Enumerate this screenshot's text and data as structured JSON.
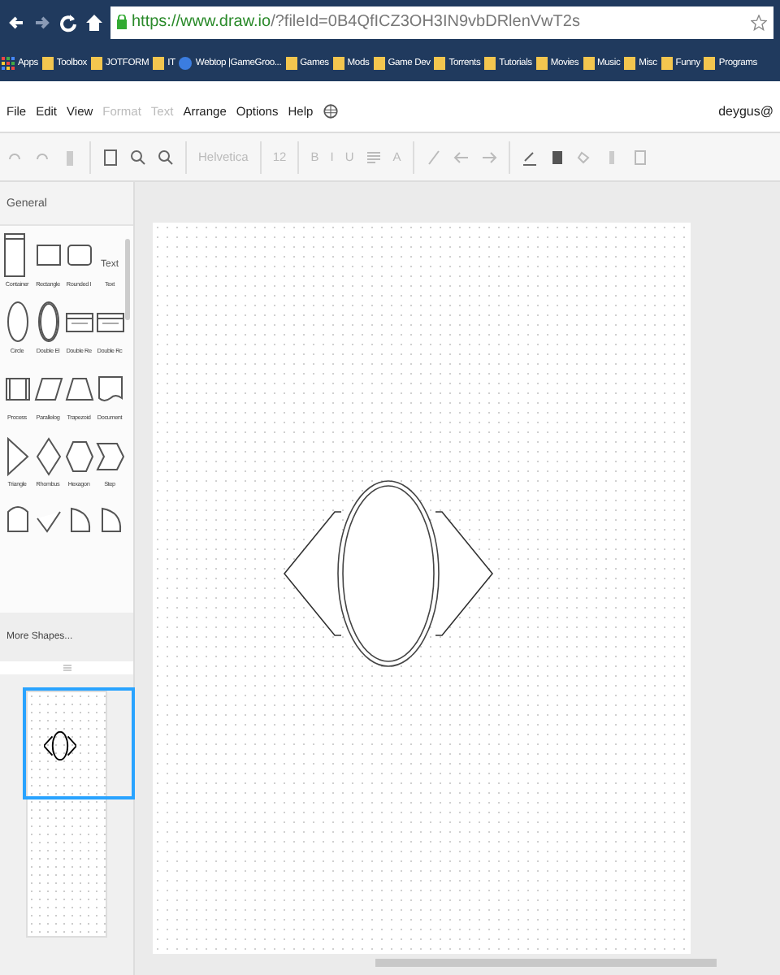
{
  "browser": {
    "url_host": "https://www.draw.io",
    "url_rest": "/?fileId=0B4QfICZ3OH3IN9vbDRlenVwT2s",
    "bookmarks": [
      {
        "label": "Apps",
        "kind": "apps"
      },
      {
        "label": "Toolbox",
        "kind": "folder"
      },
      {
        "label": "JOTFORM",
        "kind": "folder"
      },
      {
        "label": "IT",
        "kind": "folder"
      },
      {
        "label": "Webtop |GameGroo...",
        "kind": "site"
      },
      {
        "label": "Games",
        "kind": "folder"
      },
      {
        "label": "Mods",
        "kind": "folder"
      },
      {
        "label": "Game Dev",
        "kind": "folder"
      },
      {
        "label": "Torrents",
        "kind": "folder"
      },
      {
        "label": "Tutorials",
        "kind": "folder"
      },
      {
        "label": "Movies",
        "kind": "folder"
      },
      {
        "label": "Music",
        "kind": "folder"
      },
      {
        "label": "Misc",
        "kind": "folder"
      },
      {
        "label": "Funny",
        "kind": "folder"
      },
      {
        "label": "Programs",
        "kind": "folder"
      }
    ]
  },
  "menu": {
    "items": [
      {
        "label": "File",
        "disabled": false
      },
      {
        "label": "Edit",
        "disabled": false
      },
      {
        "label": "View",
        "disabled": false
      },
      {
        "label": "Format",
        "disabled": true
      },
      {
        "label": "Text",
        "disabled": true
      },
      {
        "label": "Arrange",
        "disabled": false
      },
      {
        "label": "Options",
        "disabled": false
      },
      {
        "label": "Help",
        "disabled": false
      }
    ],
    "user": "deygus@"
  },
  "toolbar": {
    "font": "Helvetica",
    "size": "12",
    "format_buttons": [
      "B",
      "I",
      "U"
    ],
    "color_button": "A"
  },
  "sidebar": {
    "section": "General",
    "shape_rows": [
      [
        {
          "kind": "container",
          "label": "Container"
        },
        {
          "kind": "rectangle",
          "label": "Rectangle"
        },
        {
          "kind": "rounded",
          "label": "Rounded I"
        },
        {
          "kind": "text",
          "label": "Text",
          "preview": "Text"
        }
      ],
      [
        {
          "kind": "circle",
          "label": "Circle"
        },
        {
          "kind": "ellipse",
          "label": "Double El"
        },
        {
          "kind": "doublerect",
          "label": "Double Re"
        },
        {
          "kind": "doublerect",
          "label": "Double Rc"
        }
      ],
      [
        {
          "kind": "process",
          "label": "Process"
        },
        {
          "kind": "parallelogram",
          "label": "Parallelog"
        },
        {
          "kind": "trapezoid",
          "label": "Trapezoid"
        },
        {
          "kind": "document",
          "label": "Document"
        }
      ],
      [
        {
          "kind": "triangle",
          "label": "Triangle"
        },
        {
          "kind": "rhombus",
          "label": "Rhombus"
        },
        {
          "kind": "hexagon",
          "label": "Hexagon"
        },
        {
          "kind": "step",
          "label": "Step"
        }
      ],
      [
        {
          "kind": "cylinder"
        },
        {
          "kind": "wave"
        },
        {
          "kind": "delay"
        },
        {
          "kind": "delay"
        }
      ]
    ],
    "more_shapes": "More Shapes..."
  }
}
